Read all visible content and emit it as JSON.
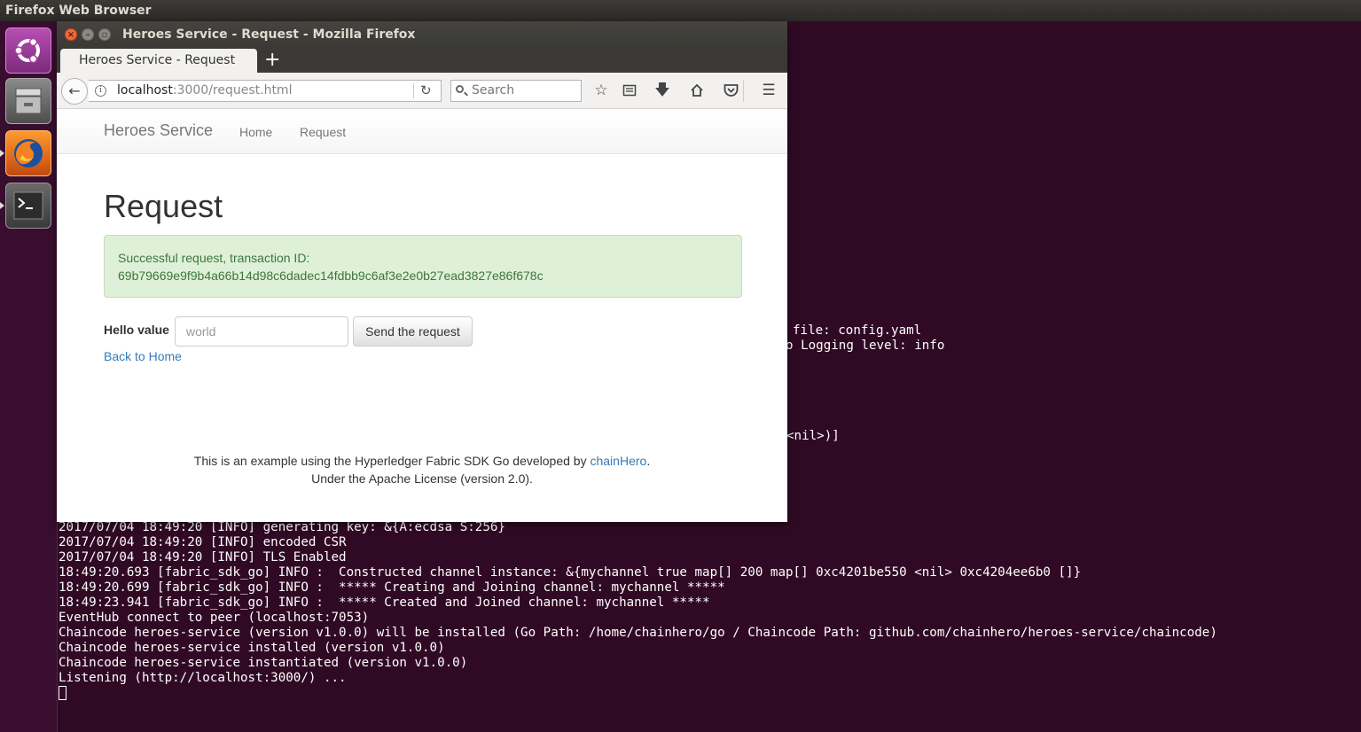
{
  "system": {
    "panel_title": "Firefox Web Browser",
    "launcher": [
      {
        "name": "ubuntu-dash"
      },
      {
        "name": "files"
      },
      {
        "name": "firefox"
      },
      {
        "name": "terminal"
      }
    ]
  },
  "browser": {
    "window_title": "Heroes Service - Request - Mozilla Firefox",
    "tab_label": "Heroes Service - Request",
    "new_tab_glyph": "+",
    "url_host": "localhost",
    "url_rest": ":3000/request.html",
    "search_placeholder": "Search"
  },
  "page": {
    "brand": "Heroes Service",
    "nav": [
      "Home",
      "Request"
    ],
    "title": "Request",
    "alert_line1": "Successful request, transaction ID:",
    "alert_line2": "69b79669e9f9b4a66b14d98c6dadec14fdbb9c6af3e2e0b27ead3827e86f678c",
    "form_label": "Hello value",
    "input_placeholder": "world",
    "send_button": "Send the request",
    "back_link": "Back to Home",
    "footer_pre": "This is an example using the Hyperledger Fabric SDK Go developed by ",
    "footer_link": "chainHero",
    "footer_post": ".",
    "footer_line2": "Under the Apache License (version 2.0)."
  },
  "terminal": {
    "partial_lines": [
      "file: config.yaml",
      "o Logging level: info",
      "<nil>)]"
    ],
    "lines": [
      "2017/07/04 18:49:20 [INFO] generating key: &{A:ecdsa S:256}",
      "2017/07/04 18:49:20 [INFO] encoded CSR",
      "2017/07/04 18:49:20 [INFO] TLS Enabled",
      "18:49:20.693 [fabric_sdk_go] INFO :  Constructed channel instance: &{mychannel true map[] 200 map[] 0xc4201be550 <nil> 0xc4204ee6b0 []}",
      "18:49:20.699 [fabric_sdk_go] INFO :  ***** Creating and Joining channel: mychannel *****",
      "18:49:23.941 [fabric_sdk_go] INFO :  ***** Created and Joined channel: mychannel *****",
      "EventHub connect to peer (localhost:7053)",
      "Chaincode heroes-service (version v1.0.0) will be installed (Go Path: /home/chainhero/go / Chaincode Path: github.com/chainhero/heroes-service/chaincode)",
      "Chaincode heroes-service installed (version v1.0.0)",
      "Chaincode heroes-service instantiated (version v1.0.0)",
      "Listening (http://localhost:3000/) ..."
    ]
  }
}
